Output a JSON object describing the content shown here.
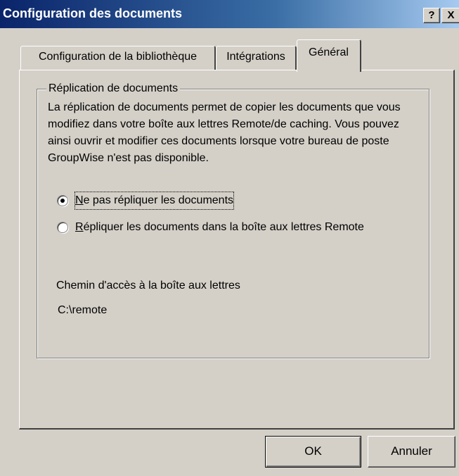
{
  "window": {
    "title": "Configuration des documents",
    "help_glyph": "?",
    "close_glyph": "X"
  },
  "tabs": [
    {
      "label": "Configuration de la bibliothèque",
      "selected": false
    },
    {
      "label": "Intégrations",
      "selected": false
    },
    {
      "label": "Général",
      "selected": true
    }
  ],
  "replication": {
    "group_label": "Réplication de documents",
    "description": "La réplication de documents permet de copier les documents que vous modifiez dans votre boîte aux lettres Remote/de caching. Vous pouvez ainsi ouvrir et modifier ces documents lorsque votre bureau de poste GroupWise n'est pas disponible.",
    "options": [
      {
        "mnemonic": "N",
        "rest": "e pas répliquer les documents",
        "checked": true
      },
      {
        "mnemonic": "R",
        "rest": "épliquer les documents dans la boîte aux lettres Remote",
        "checked": false
      }
    ],
    "path_label": "Chemin d'accès à la boîte aux lettres",
    "path_value": "C:\\remote"
  },
  "buttons": {
    "ok": "OK",
    "cancel": "Annuler"
  },
  "colors": {
    "titlebar_start": "#0a246a",
    "titlebar_end": "#a6caf0",
    "face": "#d4d0c8"
  },
  "icons": [
    "help-icon",
    "close-icon",
    "radio-checked-icon",
    "radio-unchecked-icon"
  ]
}
